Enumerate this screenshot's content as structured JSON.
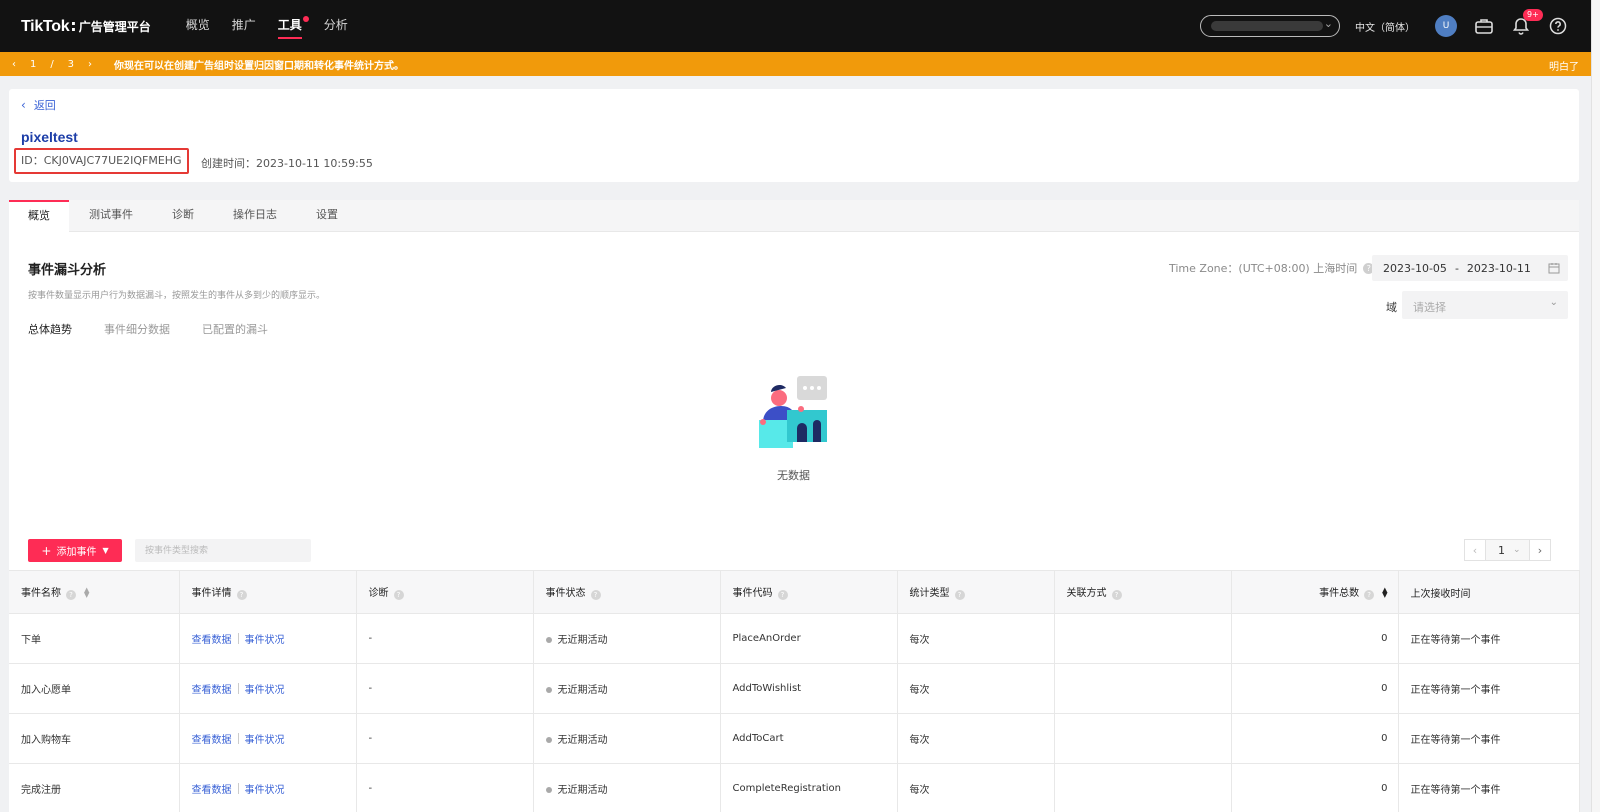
{
  "header": {
    "logo_main": "TikTok",
    "logo_sep": ":",
    "logo_sub": "广告管理平台",
    "nav": [
      {
        "label": "概览"
      },
      {
        "label": "推广"
      },
      {
        "label": "工具"
      },
      {
        "label": "分析"
      }
    ],
    "active_nav": "工具",
    "language": "中文（简体）",
    "avatar_letter": "U",
    "notification_badge": "9+"
  },
  "notice": {
    "page_current": "1",
    "page_sep": "/",
    "page_total": "3",
    "text": "你现在可以在创建广告组时设置归因窗口期和转化事件统计方式。",
    "dismiss_label": "明白了"
  },
  "pixel": {
    "back_label": "返回",
    "name": "pixeltest",
    "id_text": "ID：CKJ0VAJC77UE2IQFMEHG",
    "created_text": "创建时间：2023-10-11 10:59:55"
  },
  "tabs": [
    {
      "label": "概览"
    },
    {
      "label": "测试事件"
    },
    {
      "label": "诊断"
    },
    {
      "label": "操作日志"
    },
    {
      "label": "设置"
    }
  ],
  "funnel": {
    "title": "事件漏斗分析",
    "description": "按事件数量显示用户行为数据漏斗，按照发生的事件从多到少的顺序显示。",
    "subtabs": [
      {
        "label": "总体趋势"
      },
      {
        "label": "事件细分数据"
      },
      {
        "label": "已配置的漏斗"
      }
    ],
    "timezone": "Time Zone：(UTC+08:00) 上海时间",
    "date_start": "2023-10-05",
    "date_sep": "-",
    "date_end": "2023-10-11",
    "domain_label": "域",
    "domain_placeholder": "请选择",
    "empty_text": "无数据"
  },
  "events_toolbar": {
    "add_label": "添加事件",
    "search_placeholder": "按事件类型搜索",
    "page": "1"
  },
  "table": {
    "headers": {
      "name": "事件名称",
      "details": "事件详情",
      "diagnosis": "诊断",
      "status": "事件状态",
      "code": "事件代码",
      "stat_type": "统计类型",
      "association": "关联方式",
      "total": "事件总数",
      "last_received": "上次接收时间"
    },
    "rows": [
      {
        "name": "下单",
        "view_data": "查看数据",
        "event_status_link": "事件状况",
        "diagnosis": "-",
        "status": "无近期活动",
        "code": "PlaceAnOrder",
        "stat_type": "每次",
        "association": "",
        "total": "0",
        "last_received": "正在等待第一个事件"
      },
      {
        "name": "加入心愿单",
        "view_data": "查看数据",
        "event_status_link": "事件状况",
        "diagnosis": "-",
        "status": "无近期活动",
        "code": "AddToWishlist",
        "stat_type": "每次",
        "association": "",
        "total": "0",
        "last_received": "正在等待第一个事件"
      },
      {
        "name": "加入购物车",
        "view_data": "查看数据",
        "event_status_link": "事件状况",
        "diagnosis": "-",
        "status": "无近期活动",
        "code": "AddToCart",
        "stat_type": "每次",
        "association": "",
        "total": "0",
        "last_received": "正在等待第一个事件"
      },
      {
        "name": "完成注册",
        "view_data": "查看数据",
        "event_status_link": "事件状况",
        "diagnosis": "-",
        "status": "无近期活动",
        "code": "CompleteRegistration",
        "stat_type": "每次",
        "association": "",
        "total": "0",
        "last_received": "正在等待第一个事件"
      }
    ]
  },
  "colors": {
    "brand": "#fe2c55",
    "notice_bg": "#f19a0b",
    "link": "#3b63d6",
    "topbar": "#121212"
  }
}
